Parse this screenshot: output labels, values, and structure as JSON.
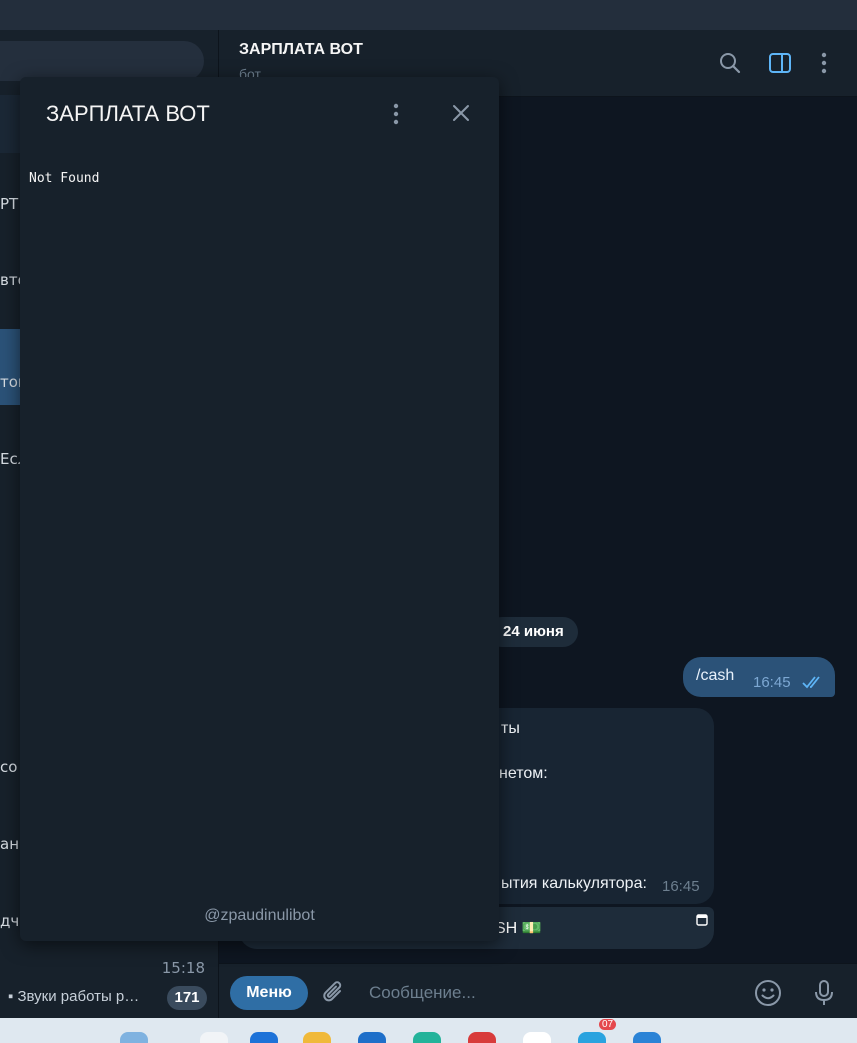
{
  "chat_list": {
    "fragments": [
      "РТ:",
      "вто",
      "том",
      "Есл",
      "со",
      "анн",
      "дч"
    ],
    "last_item": {
      "time": "15:18",
      "preview": "▪ Звуки работы р…",
      "unread_count": "171"
    }
  },
  "header": {
    "title": "ЗАРПЛАТА ВОТ",
    "subtitle": "бот",
    "icons": [
      "search-icon",
      "sidebar-toggle-icon",
      "more-vertical-icon"
    ]
  },
  "messages": {
    "date": "24 июня",
    "outgoing": {
      "text": "/cash",
      "time": "16:45"
    },
    "incoming": {
      "fragment_1": "ты",
      "fragment_2": "нетом:",
      "fragment_3": "ытия калькулятора:",
      "time": "16:45"
    },
    "inline_button": {
      "label": "SH 💵"
    }
  },
  "composer": {
    "menu_label": "Меню",
    "placeholder": "Сообщение...",
    "icons": [
      "attach-icon",
      "emoji-icon",
      "microphone-icon"
    ]
  },
  "popup": {
    "title": "ЗАРПЛАТА ВОТ",
    "body_text": "Not Found",
    "footer": "@zpaudinulibot",
    "icons": [
      "more-vertical-icon",
      "close-icon"
    ]
  },
  "taskbar": {
    "badge": "07"
  },
  "colors": {
    "background": "#0e1621",
    "panel": "#17212b",
    "accent": "#2f6ea5",
    "outgoing_bubble": "#2b5278",
    "incoming_bubble": "#182533"
  }
}
